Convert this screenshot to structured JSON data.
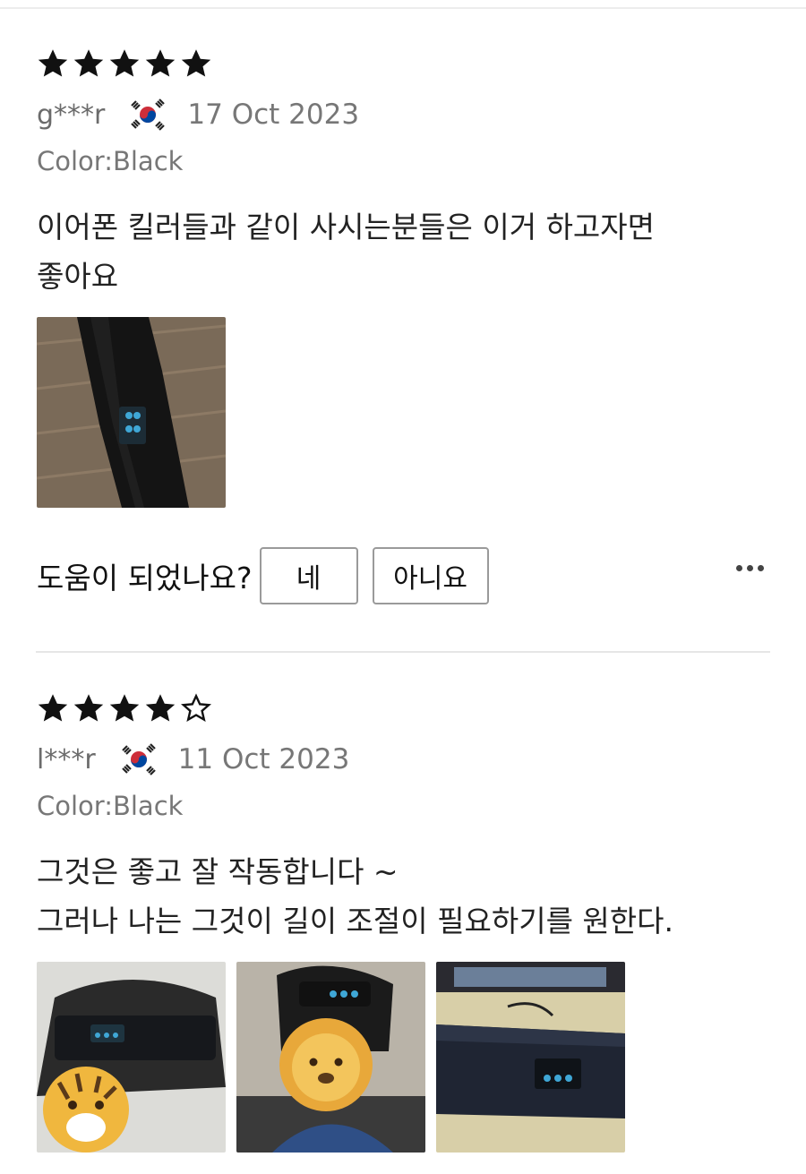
{
  "reviews": [
    {
      "rating": 5,
      "max_rating": 5,
      "username": "g***r",
      "country_flag_icon": "south-korea-flag-icon",
      "date": "17 Oct 2023",
      "variant": "Color:Black",
      "text_lines": [
        "이어폰 킬러들과 같이 사시는분들은 이거 하고자면",
        "좋아요"
      ],
      "photo_count": 1,
      "helpful": {
        "question": "도움이 되었나요?",
        "yes_label": "네",
        "no_label": "아니요"
      },
      "more_icon": "more-horizontal-icon"
    },
    {
      "rating": 4,
      "max_rating": 5,
      "username": "l***r",
      "country_flag_icon": "south-korea-flag-icon",
      "date": "11 Oct 2023",
      "variant": "Color:Black",
      "text_lines": [
        "그것은 좋고 잘 작동합니다 ~",
        "그러나 나는 그것이 길이 조절이 필요하기를 원한다."
      ],
      "photo_count": 3
    }
  ],
  "colors": {
    "star": "#111111",
    "muted_text": "#777777",
    "divider": "#e6e6e6",
    "button_border": "#9a9a9a"
  }
}
